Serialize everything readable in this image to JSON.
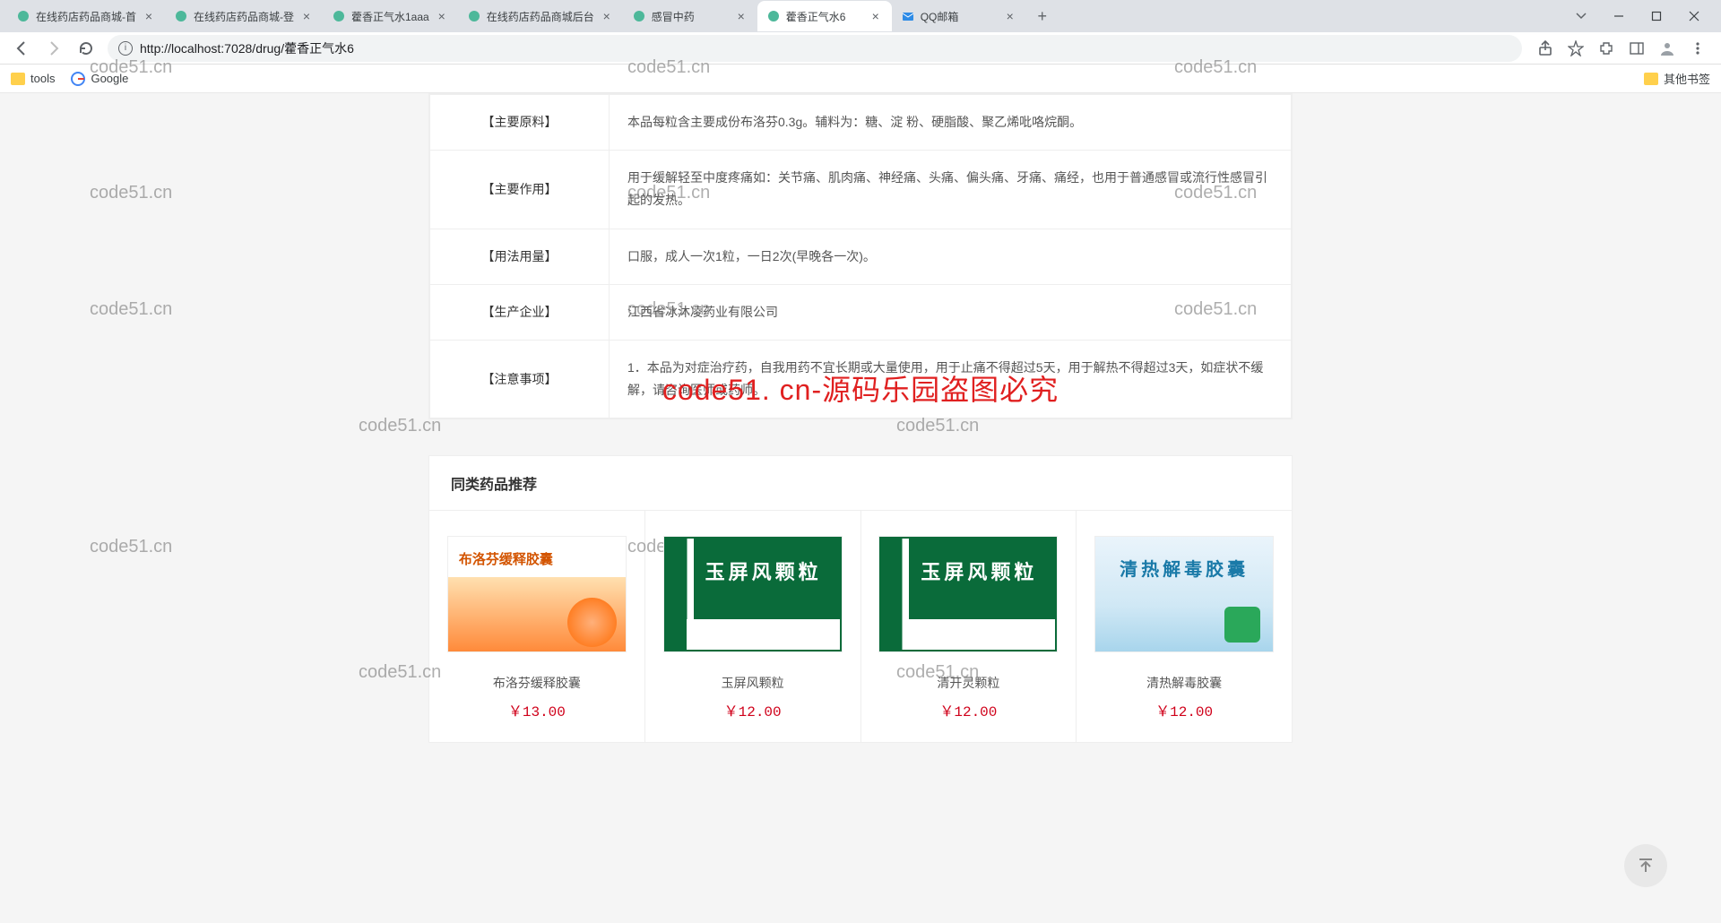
{
  "browser": {
    "tabs": [
      {
        "title": "在线药店药品商城-首",
        "active": false
      },
      {
        "title": "在线药店药品商城-登",
        "active": false
      },
      {
        "title": "藿香正气水1aaa",
        "active": false
      },
      {
        "title": "在线药店药品商城后台",
        "active": false
      },
      {
        "title": "感冒中药",
        "active": false
      },
      {
        "title": "藿香正气水6",
        "active": true
      },
      {
        "title": "QQ邮箱",
        "active": false
      }
    ],
    "url": "http://localhost:7028/drug/藿香正气水6",
    "bookmarks": {
      "tools": "tools",
      "google": "Google",
      "other": "其他书签"
    }
  },
  "detail": {
    "rows": [
      {
        "label": "【主要原料】",
        "value": "本品每粒含主要成份布洛芬0.3g。辅料为：糖、淀 粉、硬脂酸、聚乙烯吡咯烷酮。"
      },
      {
        "label": "【主要作用】",
        "value": "用于缓解轻至中度疼痛如：关节痛、肌肉痛、神经痛、头痛、偏头痛、牙痛、痛经，也用于普通感冒或流行性感冒引起的发热。"
      },
      {
        "label": "【用法用量】",
        "value": "口服，成人一次1粒，一日2次(早晚各一次)。"
      },
      {
        "label": "【生产企业】",
        "value": "江西省冰沐凌药业有限公司"
      },
      {
        "label": "【注意事项】",
        "value": "1．本品为对症治疗药，自我用药不宜长期或大量使用，用于止痛不得超过5天，用于解热不得超过3天，如症状不缓解，请咨询医师或药师。"
      }
    ]
  },
  "overlay": "code51. cn-源码乐园盗图必究",
  "recommend": {
    "title": "同类药品推荐",
    "items": [
      {
        "name": "布洛芬缓释胶囊",
        "price": "￥13.00",
        "imgText": "布洛芬缓释胶囊",
        "style": "orange"
      },
      {
        "name": "玉屏风颗粒",
        "price": "￥12.00",
        "imgText": "玉屏风颗粒",
        "style": "green"
      },
      {
        "name": "清开灵颗粒",
        "price": "￥12.00",
        "imgText": "玉屏风颗粒",
        "style": "green"
      },
      {
        "name": "清热解毒胶囊",
        "price": "￥12.00",
        "imgText": "清热解毒胶囊",
        "style": "blue"
      }
    ]
  },
  "watermark": "code51.cn"
}
